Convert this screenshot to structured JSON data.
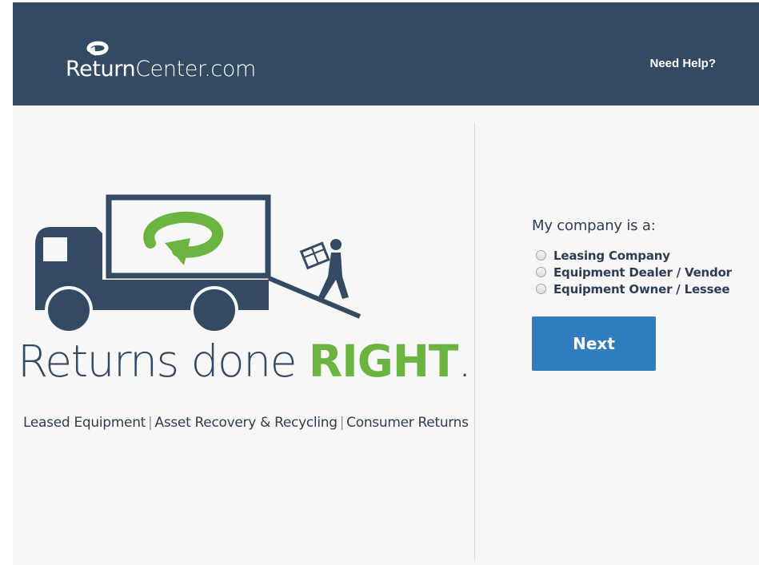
{
  "header": {
    "brand": {
      "bold": "Return",
      "rest": "Center.com"
    },
    "help_link": "Need Help?"
  },
  "hero": {
    "tagline_plain": "Returns done ",
    "tagline_highlight": "RIGHT",
    "tagline_end": ".",
    "categories": [
      "Leased Equipment",
      "Asset Recovery & Recycling",
      "Consumer Returns"
    ],
    "separator": "|"
  },
  "form": {
    "title": "My company is a:",
    "options": [
      "Leasing Company",
      "Equipment Dealer / Vendor",
      "Equipment Owner / Lessee"
    ],
    "next_label": "Next"
  },
  "colors": {
    "header_bg": "#344a62",
    "brand_green": "#6bb43f",
    "button_blue": "#2f7dbf",
    "text_navy": "#2d3e52"
  },
  "icons": [
    "return-arrow-logo-icon",
    "delivery-truck-illustration",
    "recycle-arrow-icon",
    "worker-carrying-box-icon"
  ]
}
